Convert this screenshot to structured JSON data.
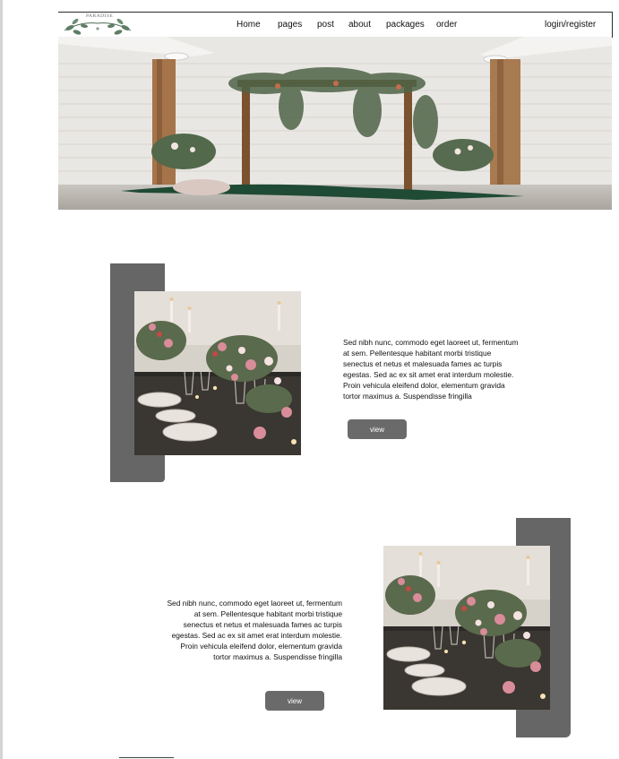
{
  "brand": {
    "logo_text": "PARADISE"
  },
  "nav": {
    "items": [
      "Home",
      "pages",
      "post",
      "about",
      "packages",
      "order"
    ],
    "login_register": "login/register"
  },
  "hero": {
    "image": "wedding-ceremony-arch-photo"
  },
  "features": [
    {
      "text": "Sed nibh nunc, commodo eget laoreet ut, fermentum at sem. Pellentesque habitant morbi tristique senectus et netus et malesuada fames ac turpis egestas. Sed ac ex sit amet erat interdum molestie. Proin vehicula eleifend dolor, elementum gravida tortor maximus a. Suspendisse fringilla",
      "button": "view",
      "image": "table-setting-flowers-photo"
    },
    {
      "text": "Sed nibh nunc, commodo eget laoreet ut, fermentum at sem. Pellentesque habitant morbi tristique senectus et netus et malesuada fames ac turpis egestas. Sed ac ex sit amet erat interdum molestie. Proin vehicula eleifend dolor, elementum gravida tortor maximus a. Suspendisse fringilla",
      "button": "view",
      "image": "table-setting-flowers-photo"
    }
  ],
  "colors": {
    "panel": "#666666",
    "button": "#6a6a6a",
    "button_text": "#ffffff"
  }
}
